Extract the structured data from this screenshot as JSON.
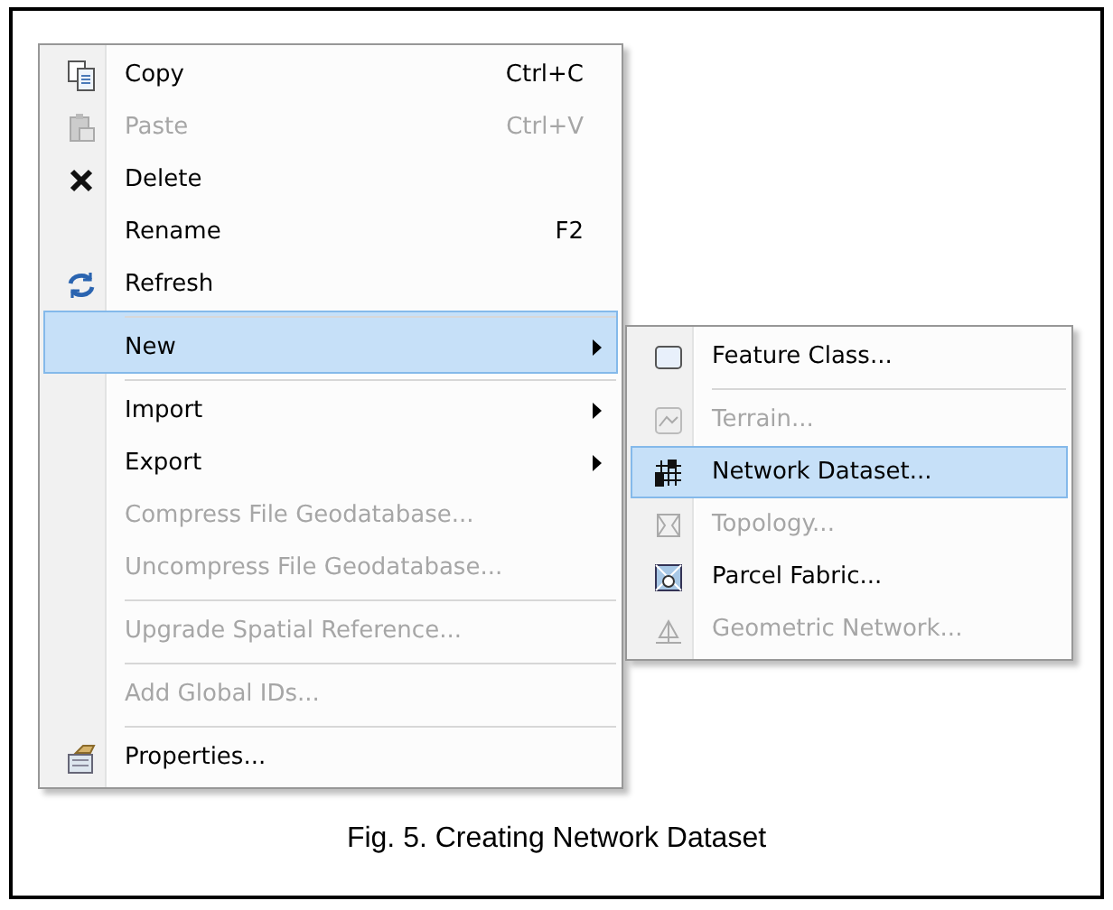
{
  "context_menu": {
    "items": [
      {
        "label": "Copy",
        "shortcut": "Ctrl+C",
        "disabled": false,
        "selected": false,
        "submenu": false,
        "separator_above": false
      },
      {
        "label": "Paste",
        "shortcut": "Ctrl+V",
        "disabled": true,
        "selected": false,
        "submenu": false,
        "separator_above": false
      },
      {
        "label": "Delete",
        "disabled": false,
        "selected": false,
        "submenu": false,
        "separator_above": false
      },
      {
        "label": "Rename",
        "shortcut": "F2",
        "disabled": false,
        "selected": false,
        "submenu": false,
        "separator_above": false
      },
      {
        "label": "Refresh",
        "disabled": false,
        "selected": false,
        "submenu": false,
        "separator_above": false
      },
      {
        "label": "New",
        "disabled": false,
        "selected": true,
        "submenu": true,
        "separator_above": true
      },
      {
        "label": "Import",
        "disabled": false,
        "selected": false,
        "submenu": true,
        "separator_above": true
      },
      {
        "label": "Export",
        "disabled": false,
        "selected": false,
        "submenu": true,
        "separator_above": false
      },
      {
        "label": "Compress File Geodatabase...",
        "disabled": true,
        "selected": false,
        "submenu": false,
        "separator_above": false
      },
      {
        "label": "Uncompress File Geodatabase...",
        "disabled": true,
        "selected": false,
        "submenu": false,
        "separator_above": false
      },
      {
        "label": "Upgrade Spatial Reference...",
        "disabled": true,
        "selected": false,
        "submenu": false,
        "separator_above": true
      },
      {
        "label": "Add Global IDs...",
        "disabled": true,
        "selected": false,
        "submenu": false,
        "separator_above": true
      },
      {
        "label": "Properties...",
        "disabled": false,
        "selected": false,
        "submenu": false,
        "separator_above": true
      }
    ]
  },
  "submenu": {
    "items": [
      {
        "label": "Feature Class...",
        "disabled": false,
        "selected": false,
        "separator_above": false
      },
      {
        "label": "Terrain...",
        "disabled": true,
        "selected": false,
        "separator_above": true
      },
      {
        "label": "Network Dataset...",
        "disabled": false,
        "selected": true,
        "separator_above": false
      },
      {
        "label": "Topology...",
        "disabled": true,
        "selected": false,
        "separator_above": false
      },
      {
        "label": "Parcel Fabric...",
        "disabled": false,
        "selected": false,
        "separator_above": false
      },
      {
        "label": "Geometric Network...",
        "disabled": true,
        "selected": false,
        "separator_above": false
      }
    ]
  },
  "caption": "Fig. 5. Creating Network Dataset"
}
